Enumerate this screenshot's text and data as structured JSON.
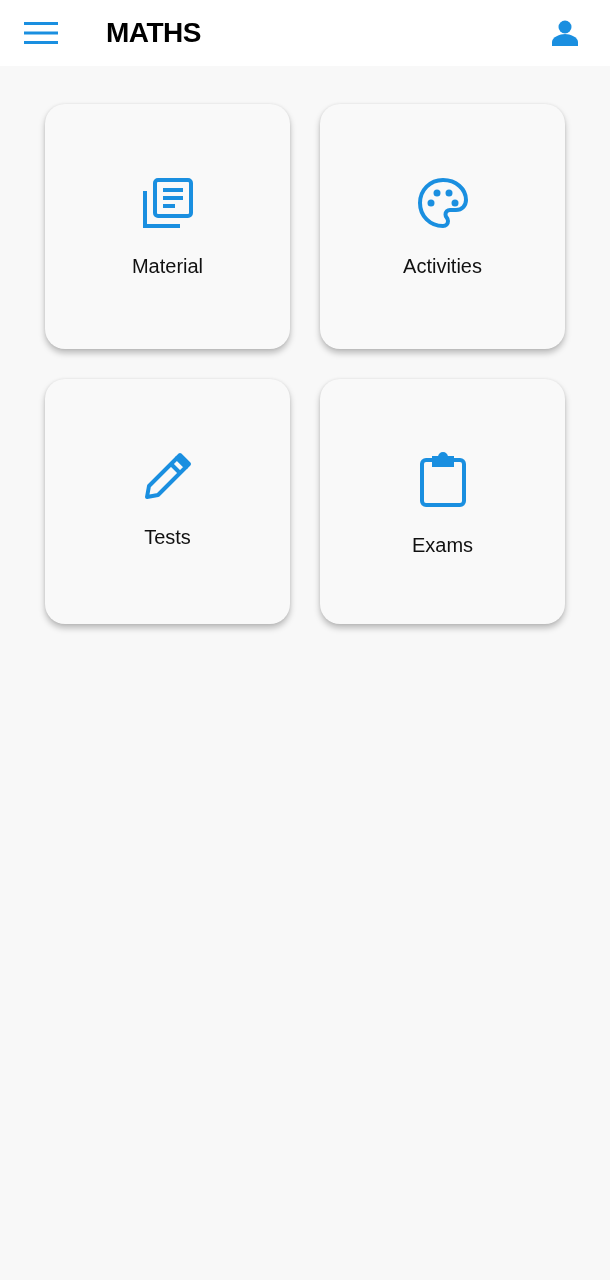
{
  "header": {
    "title": "MATHS"
  },
  "tiles": [
    {
      "label": "Material",
      "kind": "library"
    },
    {
      "label": "Activities",
      "kind": "palette"
    },
    {
      "label": "Tests",
      "kind": "pencil"
    },
    {
      "label": "Exams",
      "kind": "clipboard"
    }
  ]
}
